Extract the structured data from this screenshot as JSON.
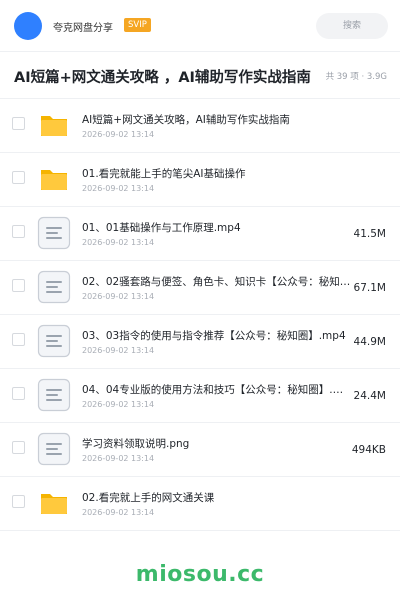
{
  "header": {
    "user_name": "夸克网盘分享",
    "badge": "SVIP",
    "search_placeholder": "搜索"
  },
  "share": {
    "title": "AI短篇+网文通关攻略 ，AI辅助写作实战指南",
    "summary": "共 39 项 · 3.9G"
  },
  "files": [
    {
      "type": "folder",
      "name": "AI短篇+网文通关攻略，AI辅助写作实战指南",
      "date": "2026-09-02 13:14",
      "size": ""
    },
    {
      "type": "folder",
      "name": "01.看完就能上手的笔尖AI基础操作",
      "date": "2026-09-02 13:14",
      "size": ""
    },
    {
      "type": "document",
      "name": "01、01基础操作与工作原理.mp4",
      "date": "2026-09-02 13:14",
      "size": "41.5M"
    },
    {
      "type": "document",
      "name": "02、02骚套路与便签、角色卡、知识卡【公众号：秘知圈】.mp4",
      "date": "2026-09-02 13:14",
      "size": "67.1M"
    },
    {
      "type": "document",
      "name": "03、03指令的使用与指令推荐【公众号：秘知圈】.mp4",
      "date": "2026-09-02 13:14",
      "size": "44.9M"
    },
    {
      "type": "document",
      "name": "04、04专业版的使用方法和技巧【公众号：秘知圈】.mp4",
      "date": "2026-09-02 13:14",
      "size": "24.4M"
    },
    {
      "type": "document",
      "name": "学习资料领取说明.png",
      "date": "2026-09-02 13:14",
      "size": "494KB"
    },
    {
      "type": "folder",
      "name": "02.看完就上手的网文通关课",
      "date": "2026-09-02 13:14",
      "size": ""
    }
  ],
  "footer": {
    "brand": "miosou.cc"
  },
  "colors": {
    "accent": "#2f80ff",
    "svip": "#f5a623",
    "folder": "#ffc93d",
    "brand": "#3cb96b"
  }
}
